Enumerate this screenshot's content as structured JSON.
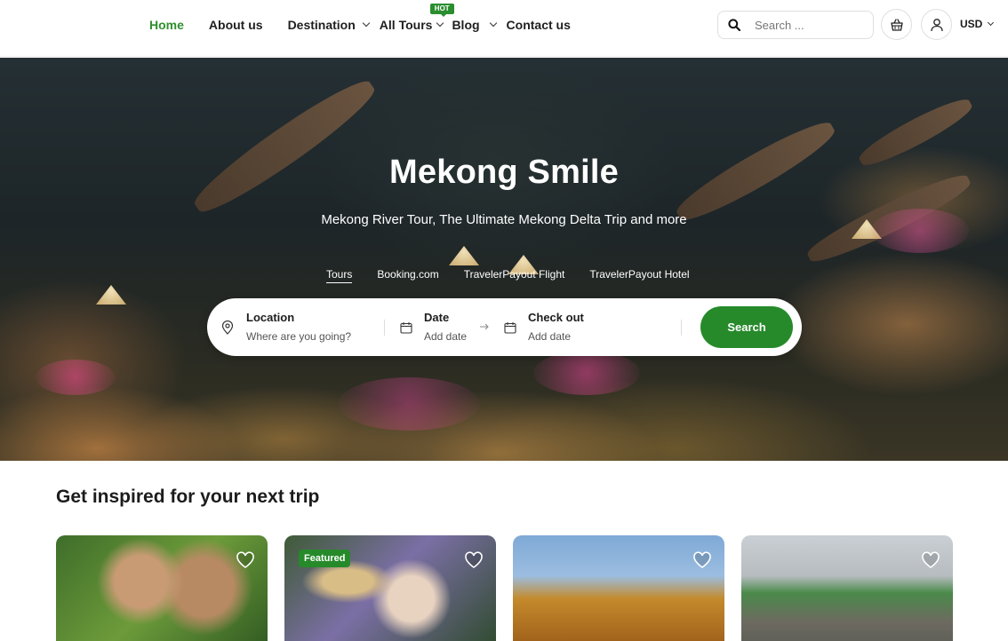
{
  "nav": {
    "items": [
      {
        "label": "Home",
        "active": true
      },
      {
        "label": "About us"
      },
      {
        "label": "Destination",
        "dropdown": true
      },
      {
        "label": "All Tours",
        "dropdown": true,
        "badge": "HOT"
      },
      {
        "label": "Blog",
        "dropdown": true
      },
      {
        "label": "Contact us"
      }
    ],
    "search_placeholder": "Search ...",
    "currency": "USD",
    "icons": [
      "search-icon",
      "basket-icon",
      "user-icon",
      "chevron-down-icon"
    ]
  },
  "hero": {
    "title": "Mekong Smile",
    "subtitle": "Mekong River Tour, The Ultimate Mekong Delta Trip and more",
    "tabs": [
      {
        "label": "Tours",
        "active": true
      },
      {
        "label": "Booking.com"
      },
      {
        "label": "TravelerPayout Flight"
      },
      {
        "label": "TravelerPayout Hotel"
      }
    ],
    "search_bar": {
      "location_label": "Location",
      "location_placeholder": "Where are you going?",
      "date_label": "Date",
      "date_placeholder": "Add date",
      "checkout_label": "Check out",
      "checkout_placeholder": "Add date",
      "button_label": "Search"
    }
  },
  "inspired": {
    "title": "Get inspired for your next trip",
    "cards": [
      {
        "badge": ""
      },
      {
        "badge": "Featured"
      },
      {
        "badge": ""
      },
      {
        "badge": ""
      }
    ]
  },
  "colors": {
    "accent": "#268a2a",
    "nav_active": "#2f8f2e"
  }
}
